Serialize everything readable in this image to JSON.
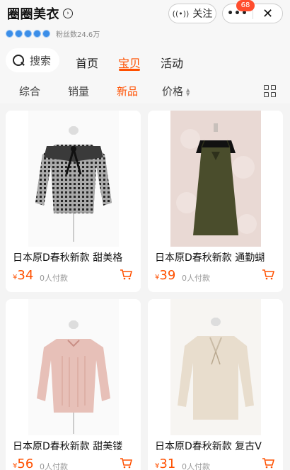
{
  "shop": {
    "name": "圈圈美衣",
    "fans_text": "粉丝数24.6万",
    "badge_count": 5
  },
  "header": {
    "follow_label": "关注",
    "notification_count": "68"
  },
  "search": {
    "label": "搜索"
  },
  "tabs": [
    {
      "label": "首页",
      "active": false
    },
    {
      "label": "宝贝",
      "active": true
    },
    {
      "label": "活动",
      "active": false
    }
  ],
  "sort": [
    {
      "label": "综合",
      "active": false
    },
    {
      "label": "销量",
      "active": false
    },
    {
      "label": "新品",
      "active": true
    },
    {
      "label": "价格",
      "active": false
    }
  ],
  "currency": "¥",
  "products": [
    {
      "title": "日本原D春秋新款 甜美格",
      "price": "34",
      "sold": "0人付款",
      "color": "#2a2a2a",
      "style": "gingham-blouse"
    },
    {
      "title": "日本原D春秋新款 通勤蝴",
      "price": "39",
      "sold": "0人付款",
      "color": "#4a4d2c",
      "style": "slip-dress"
    },
    {
      "title": "日本原D春秋新款 甜美镂",
      "price": "56",
      "sold": "0人付款",
      "color": "#e7c0b8",
      "style": "pink-blouse"
    },
    {
      "title": "日本原D春秋新款 复古V",
      "price": "31",
      "sold": "0人付款",
      "color": "#e8ddcd",
      "style": "cream-blouse"
    }
  ],
  "colors": {
    "accent": "#ff5000",
    "background": "#f4f4f4"
  }
}
